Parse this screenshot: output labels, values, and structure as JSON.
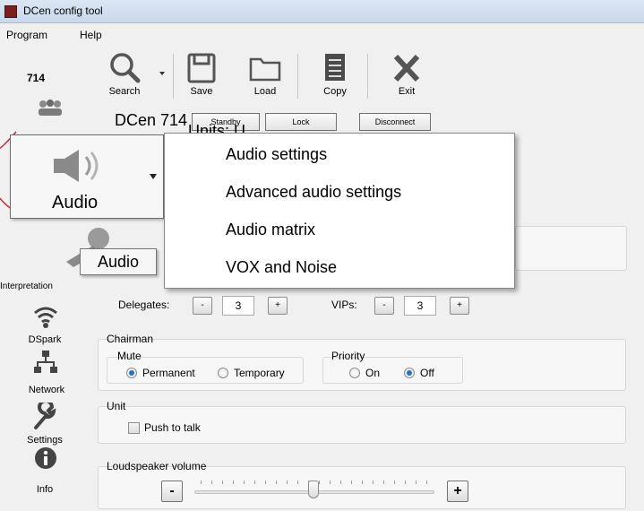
{
  "window": {
    "title": "DCen config tool"
  },
  "menu": {
    "items": [
      "Program",
      "Help"
    ]
  },
  "nav": {
    "device_label": "714",
    "items": [
      {
        "label": "Interpretation",
        "icon": "interpretation-icon"
      },
      {
        "label": "DSpark",
        "icon": "wifi-icon"
      },
      {
        "label": "Network",
        "icon": "network-icon"
      },
      {
        "label": "Settings",
        "icon": "wrench-icon"
      },
      {
        "label": "Info",
        "icon": "info-icon"
      }
    ]
  },
  "toolbar": {
    "search": "Search",
    "save": "Save",
    "load": "Load",
    "copy": "Copy",
    "exit": "Exit"
  },
  "device": {
    "title": "DCen 714",
    "units_partial": "Units: U",
    "standby": "Standby",
    "lock": "Lock",
    "disconnect": "Disconnect"
  },
  "audio_button": {
    "label": "Audio",
    "icon": "speaker-icon"
  },
  "audio_menu": {
    "items": [
      "Audio settings",
      "Advanced audio settings",
      "Audio matrix",
      "VOX and Noise"
    ]
  },
  "tooltip": "Audio",
  "delegates": {
    "label": "Delegates:",
    "value": "3",
    "minus": "-",
    "plus": "+"
  },
  "vips": {
    "label": "VIPs:",
    "value": "3",
    "minus": "-",
    "plus": "+"
  },
  "chairman": {
    "title": "Chairman",
    "mute": {
      "title": "Mute",
      "options": [
        "Permanent",
        "Temporary"
      ],
      "selected": "Permanent"
    },
    "priority": {
      "title": "Priority",
      "options": [
        "On",
        "Off"
      ],
      "selected": "Off"
    }
  },
  "unit": {
    "title": "Unit",
    "push_to_talk": "Push to talk",
    "push_to_talk_checked": false
  },
  "loudspeaker": {
    "title": "Loudspeaker volume",
    "minus": "-",
    "plus": "+",
    "level": 0.5
  }
}
